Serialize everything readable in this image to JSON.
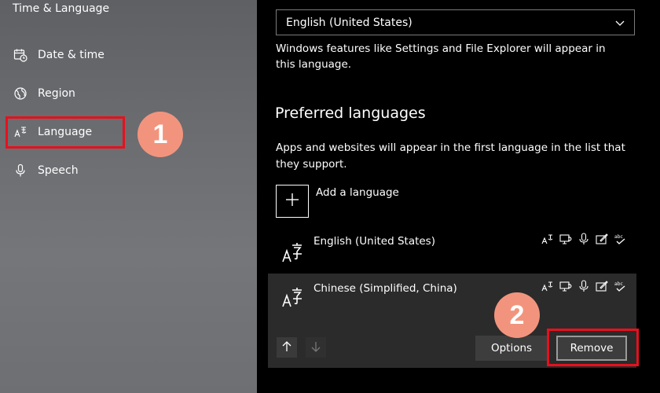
{
  "sidebar": {
    "title": "Time & Language",
    "items": [
      {
        "label": "Date & time",
        "icon": "calendar-clock-icon"
      },
      {
        "label": "Region",
        "icon": "globe-icon"
      },
      {
        "label": "Language",
        "icon": "language-icon"
      },
      {
        "label": "Speech",
        "icon": "microphone-icon"
      }
    ]
  },
  "annotations": {
    "step1": "1",
    "step2": "2"
  },
  "main": {
    "display_language": "English (United States)",
    "display_desc": "Windows features like Settings and File Explorer will appear in this language.",
    "preferred_heading": "Preferred languages",
    "preferred_desc": "Apps and websites will appear in the first language in the list that they support.",
    "add_language": "Add a language",
    "languages": [
      {
        "name": "English (United States)"
      },
      {
        "name": "Chinese (Simplified, China)"
      }
    ],
    "options_label": "Options",
    "remove_label": "Remove"
  },
  "colors": {
    "highlight": "#e8101d",
    "badge": "#f2947d",
    "selected_row": "#2b2b2b"
  }
}
